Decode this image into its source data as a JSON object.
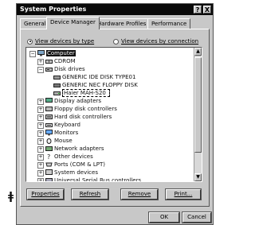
{
  "side_glyph": "ǂ",
  "window": {
    "title": "System Properties",
    "help_button": "?",
    "close_button": "X"
  },
  "tabs": [
    {
      "label": "General"
    },
    {
      "label": "Device Manager"
    },
    {
      "label": "Hardware Profiles"
    },
    {
      "label": "Performance"
    }
  ],
  "view": {
    "by_type_label": "View devices by type",
    "by_connection_label": "View devices by connection",
    "selected": "by_type"
  },
  "tree": [
    {
      "label": "Computer",
      "icon": "computer-icon",
      "level": 0,
      "expander": "−",
      "state": "selected"
    },
    {
      "label": "CDROM",
      "icon": "cdrom-icon",
      "level": 1,
      "expander": "+"
    },
    {
      "label": "Disk drives",
      "icon": "disk-drive-icon",
      "level": 1,
      "expander": "−"
    },
    {
      "label": "GENERIC IDE  DISK TYPE01",
      "icon": "hard-disk-icon",
      "level": 2
    },
    {
      "label": "GENERIC NEC  FLOPPY DISK",
      "icon": "floppy-disk-icon",
      "level": 2
    },
    {
      "label": "Haier MAH-S20",
      "icon": "usb-disk-icon",
      "level": 2,
      "state": "focus"
    },
    {
      "label": "Display adapters",
      "icon": "display-adapter-icon",
      "level": 1,
      "expander": "+"
    },
    {
      "label": "Floppy disk controllers",
      "icon": "floppy-controller-icon",
      "level": 1,
      "expander": "+"
    },
    {
      "label": "Hard disk controllers",
      "icon": "hard-disk-controller-icon",
      "level": 1,
      "expander": "+"
    },
    {
      "label": "Keyboard",
      "icon": "keyboard-icon",
      "level": 1,
      "expander": "+"
    },
    {
      "label": "Monitors",
      "icon": "monitor-icon",
      "level": 1,
      "expander": "+"
    },
    {
      "label": "Mouse",
      "icon": "mouse-icon",
      "level": 1,
      "expander": "+"
    },
    {
      "label": "Network adapters",
      "icon": "network-adapter-icon",
      "level": 1,
      "expander": "+"
    },
    {
      "label": "Other devices",
      "icon": "other-devices-icon",
      "level": 1,
      "expander": "+"
    },
    {
      "label": "Ports (COM & LPT)",
      "icon": "ports-icon",
      "level": 1,
      "expander": "+"
    },
    {
      "label": "System devices",
      "icon": "system-devices-icon",
      "level": 1,
      "expander": "+"
    },
    {
      "label": "Universal Serial Bus controllers",
      "icon": "usb-controller-icon",
      "level": 1,
      "expander": "+"
    }
  ],
  "buttons": {
    "properties": "Properties",
    "refresh": "Refresh",
    "remove": "Remove",
    "print": "Print...",
    "ok": "OK",
    "cancel": "Cancel"
  }
}
